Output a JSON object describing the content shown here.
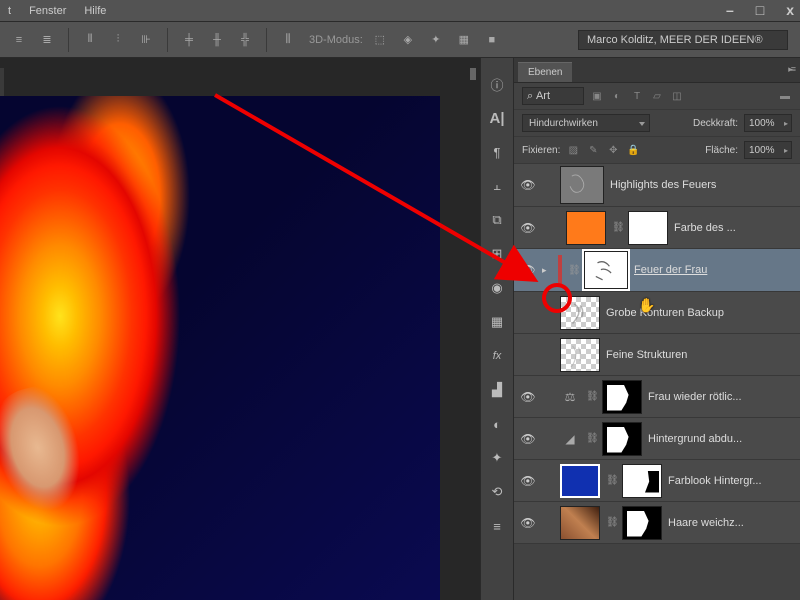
{
  "menu": {
    "items": [
      "t",
      "Fenster",
      "Hilfe"
    ]
  },
  "winbuttons": {
    "min": "–",
    "max": "□",
    "close": "x"
  },
  "optionsbar": {
    "mode3d_label": "3D-Modus:",
    "user_dropdown": "Marco Kolditz, MEER DER IDEEN®"
  },
  "panel": {
    "tab": "Ebenen",
    "search_label": "Art",
    "blend_mode": "Hindurchwirken",
    "opacity_label": "Deckkraft:",
    "opacity_value": "100%",
    "lock_label": "Fixieren:",
    "fill_label": "Fläche:",
    "fill_value": "100%"
  },
  "layers": [
    {
      "name": "Highlights des Feuers",
      "visible": true,
      "thumb": "gray-scribble"
    },
    {
      "name": "Farbe des ...",
      "visible": true,
      "thumb": "orange",
      "mask": "white",
      "indent": true
    },
    {
      "name": "Feuer der Frau",
      "visible": true,
      "thumb": "white-scribble",
      "selected": true,
      "expand": true
    },
    {
      "name": "Grobe Konturen Backup",
      "visible": false,
      "thumb": "checker-scribble"
    },
    {
      "name": "Feine Strukturen",
      "visible": false,
      "thumb": "checker-scribble"
    },
    {
      "name": "Frau wieder rötlic...",
      "visible": true,
      "adj": "balance",
      "mask": "black-shape"
    },
    {
      "name": "Hintergrund abdu...",
      "visible": true,
      "adj": "levels",
      "mask": "black-shape"
    },
    {
      "name": "Farblook Hintergr...",
      "visible": true,
      "thumb": "navy",
      "mask": "white-shape"
    },
    {
      "name": "Haare weichz...",
      "visible": true,
      "thumb": "photo",
      "mask": "black-shape"
    }
  ],
  "icons": {
    "search": "⌕"
  }
}
